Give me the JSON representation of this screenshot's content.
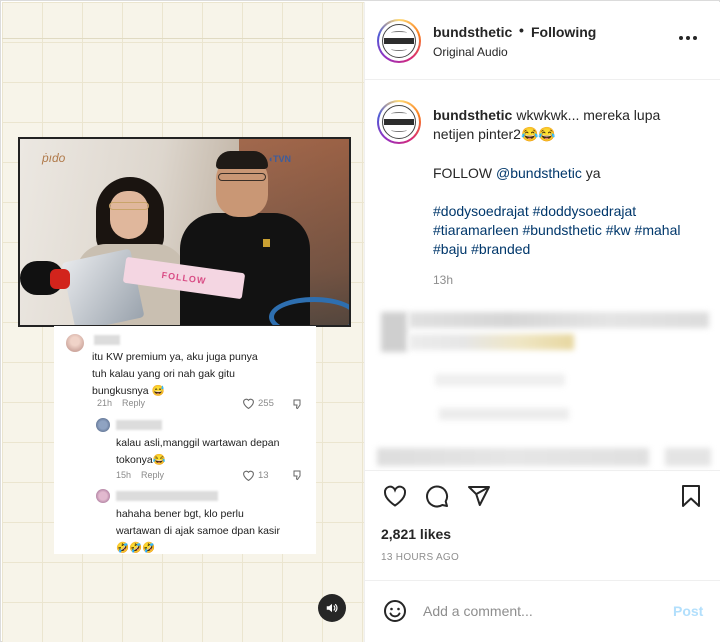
{
  "header": {
    "username": "bundsthetic",
    "separator": "•",
    "follow_status": "Following",
    "audio": "Original Audio"
  },
  "caption": {
    "username": "bundsthetic",
    "text": "wkwkwk... mereka lupa netijen pinter2😂😂",
    "follow_prefix": "FOLLOW",
    "follow_mention": "@bundsthetic",
    "follow_suffix": "ya",
    "hashtags": "#dodysoedrajat #doddysoedrajat #tiaramarleen #bundsthetic #kw #mahal #baju #branded",
    "time": "13h"
  },
  "video_comments": [
    {
      "text": "itu KW premium ya, aku juga punya tuh kalau yang ori nah gak gitu bungkusnya 😅",
      "time": "21h",
      "reply": "Reply",
      "likes": "255"
    },
    {
      "text": "kalau asli,manggil wartawan depan tokonya😂",
      "time": "15h",
      "reply": "Reply",
      "likes": "13"
    },
    {
      "text": "hahaha bener bgt, klo perlu wartawan di ajak samoe dpan kasir 🤣🤣🤣"
    }
  ],
  "footer": {
    "likes": "2,821 likes",
    "posted": "13 HOURS AGO",
    "comment_placeholder": "Add a comment...",
    "post_label": "Post"
  },
  "icons": {
    "like": "heart-icon",
    "comment": "comment-icon",
    "share": "share-icon",
    "save": "bookmark-icon",
    "emoji": "emoji-icon",
    "sound": "speaker-icon",
    "more": "more-icon"
  },
  "colors": {
    "link": "#00376b",
    "post_disabled": "#b2dffc",
    "muted": "#8e8e8e"
  }
}
